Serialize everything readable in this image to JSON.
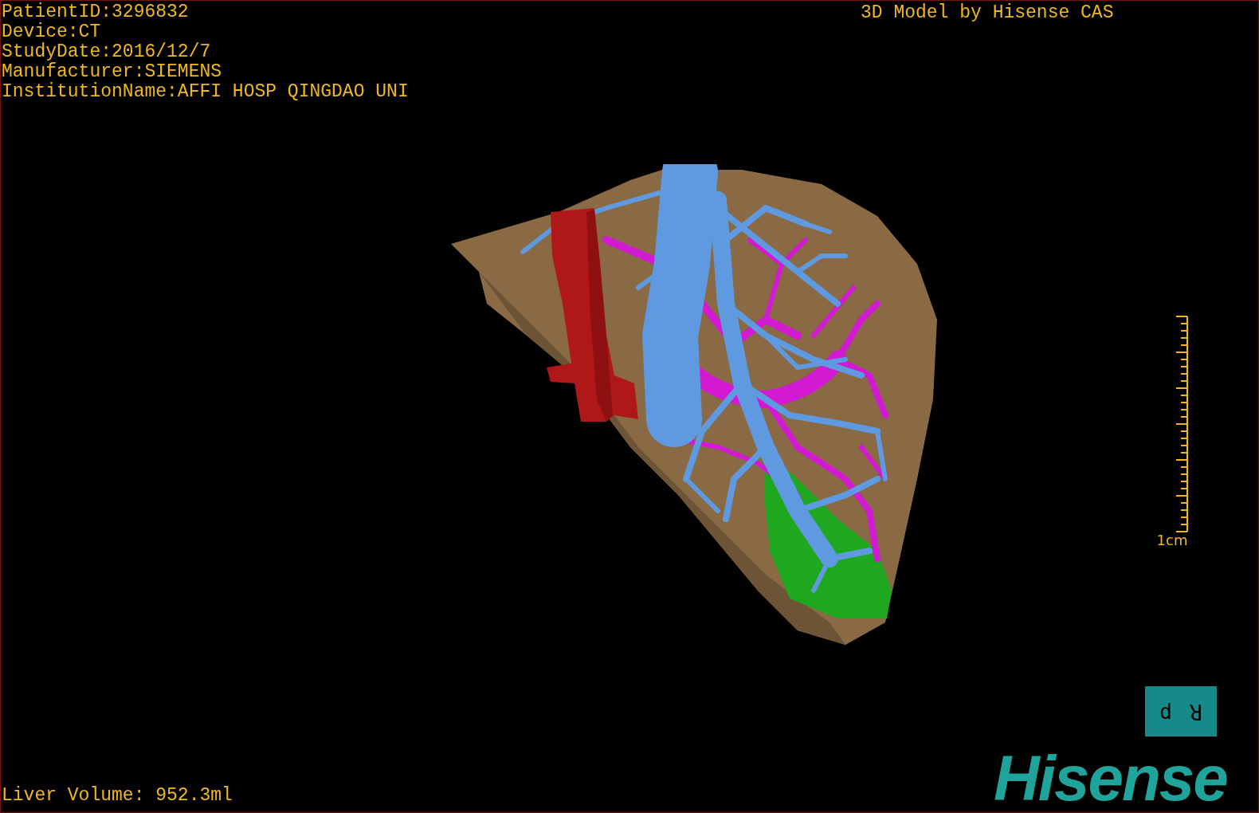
{
  "info_lines": [
    "PatientID:3296832",
    "Device:CT",
    "StudyDate:2016/12/7",
    "Manufacturer:SIEMENS",
    "InstitutionName:AFFI HOSP QINGDAO UNI"
  ],
  "title": "3D Model by Hisense CAS",
  "scale_bar": {
    "label": "1cm"
  },
  "orientation_labels": [
    "d",
    "R"
  ],
  "logo": "Hisense",
  "liver_volume": "Liver Volume: 952.3ml"
}
